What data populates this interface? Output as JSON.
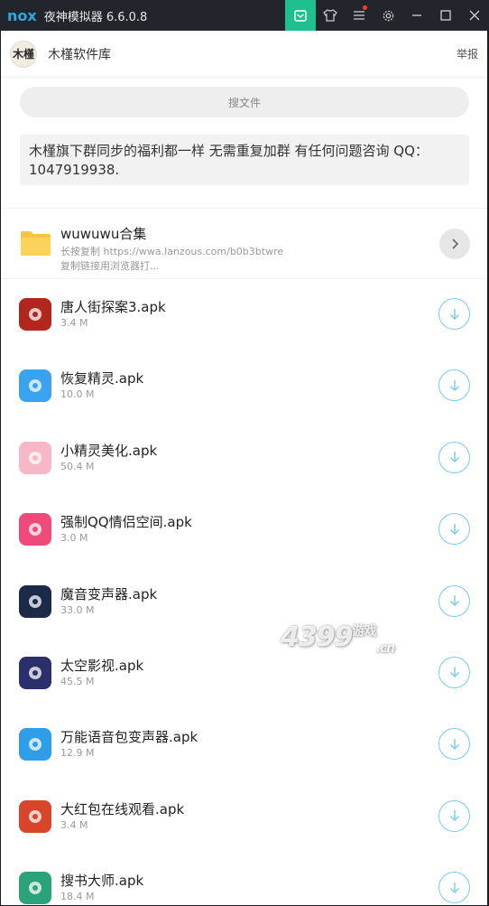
{
  "window": {
    "logo": "nox",
    "title": "夜神模拟器 6.6.0.8",
    "buttons": [
      "mail-icon",
      "shirt-icon",
      "menu-icon",
      "gear-icon",
      "minimize-icon",
      "maximize-icon",
      "close-icon"
    ]
  },
  "header": {
    "avatar_text": "木槿",
    "title": "木槿软件库",
    "report": "举报"
  },
  "search": {
    "placeholder": "搜文件"
  },
  "notice": {
    "text": "木槿旗下群同步的福利都一样 无需重复加群 有任何问题咨询 QQ：1047919938."
  },
  "folder": {
    "name": "wuwuwu合集",
    "line1": "长按复制 https://wwa.lanzous.com/b0b3btwre",
    "line2": "复制链接用浏览器打..."
  },
  "files": [
    {
      "name": "唐人街探案3.apk",
      "size": "3.4 M",
      "icon_color": "#b3261e"
    },
    {
      "name": "恢复精灵.apk",
      "size": "10.0 M",
      "icon_color": "#3aa3f0"
    },
    {
      "name": "小精灵美化.apk",
      "size": "50.4 M",
      "icon_color": "#f7b7c6"
    },
    {
      "name": "强制QQ情侣空间.apk",
      "size": "3.0 M",
      "icon_color": "#f04a7a"
    },
    {
      "name": "魔音变声器.apk",
      "size": "33.0 M",
      "icon_color": "#1c2a4a"
    },
    {
      "name": "太空影视.apk",
      "size": "45.5 M",
      "icon_color": "#2b2f6b"
    },
    {
      "name": "万能语音包变声器.apk",
      "size": "12.9 M",
      "icon_color": "#2f9ee8"
    },
    {
      "name": "大红包在线观看.apk",
      "size": "3.4 M",
      "icon_color": "#d8452a"
    },
    {
      "name": "搜书大师.apk",
      "size": "18.4 M",
      "icon_color": "#2aa37a"
    }
  ],
  "watermark": {
    "main": "4399",
    "small": "游戏",
    "sub": ".cn"
  }
}
